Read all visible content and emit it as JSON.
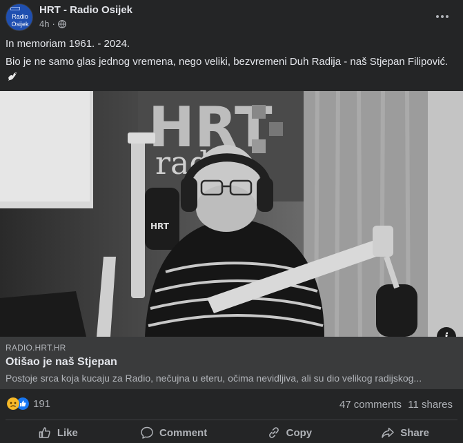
{
  "post": {
    "page_name": "HRT - Radio Osijek",
    "time": "4h",
    "audience_icon": "globe-icon",
    "avatar_text_line1": "Radio",
    "avatar_text_line2": "Osijek",
    "text_line1": "In memoriam 1961. - 2024.",
    "text_line2": "Bio je ne samo glas jednog vremena, nego veliki, bezvremeni Duh Radija - naš Stjepan Filipović.",
    "emoji": "dove-icon"
  },
  "image": {
    "sign_text_hrt": "HRT",
    "sign_text_radio": "radio",
    "mic_label": "HRT"
  },
  "link": {
    "domain": "RADIO.HRT.HR",
    "title": "Otišao je naš Stjepan",
    "description": "Postoje srca koja kucaju za Radio, nečujna u eteru, očima nevidljiva, ali su dio velikog radijskog..."
  },
  "stats": {
    "reactions_count": "191",
    "reaction_icons": [
      "sad-icon",
      "like-icon"
    ],
    "comments": "47 comments",
    "shares": "11 shares"
  },
  "actions": {
    "like": "Like",
    "comment": "Comment",
    "copy": "Copy",
    "share": "Share"
  },
  "colors": {
    "background": "#242526",
    "link_preview_bg": "#3a3b3c",
    "text_primary": "#e4e6eb",
    "text_secondary": "#b0b3b8",
    "like_blue": "#1877f2",
    "sad_yellow": "#f7b928"
  }
}
